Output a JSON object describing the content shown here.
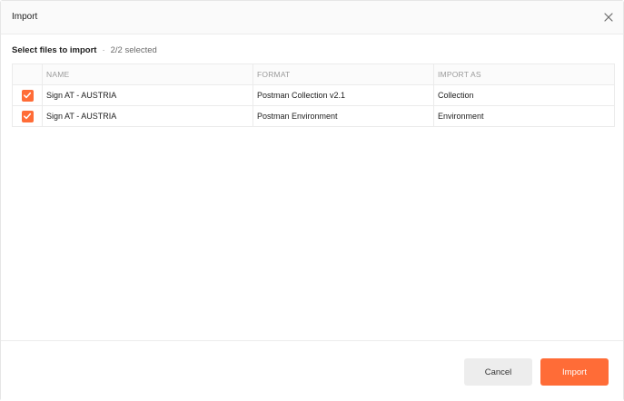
{
  "dialog": {
    "title": "Import"
  },
  "selection": {
    "heading": "Select files to import",
    "separator": "·",
    "count": "2/2 selected"
  },
  "table": {
    "columns": [
      "NAME",
      "FORMAT",
      "IMPORT AS"
    ],
    "rows": [
      {
        "checked": true,
        "name": "Sign AT - AUSTRIA",
        "format": "Postman Collection v2.1",
        "import_as": "Collection"
      },
      {
        "checked": true,
        "name": "Sign AT - AUSTRIA",
        "format": "Postman Environment",
        "import_as": "Environment"
      }
    ]
  },
  "footer": {
    "cancel_label": "Cancel",
    "import_label": "Import"
  },
  "colors": {
    "accent": "#ff6c37",
    "cancel_bg": "#ededed"
  },
  "icons": {
    "close": "close-icon",
    "check": "checkmark-icon"
  }
}
